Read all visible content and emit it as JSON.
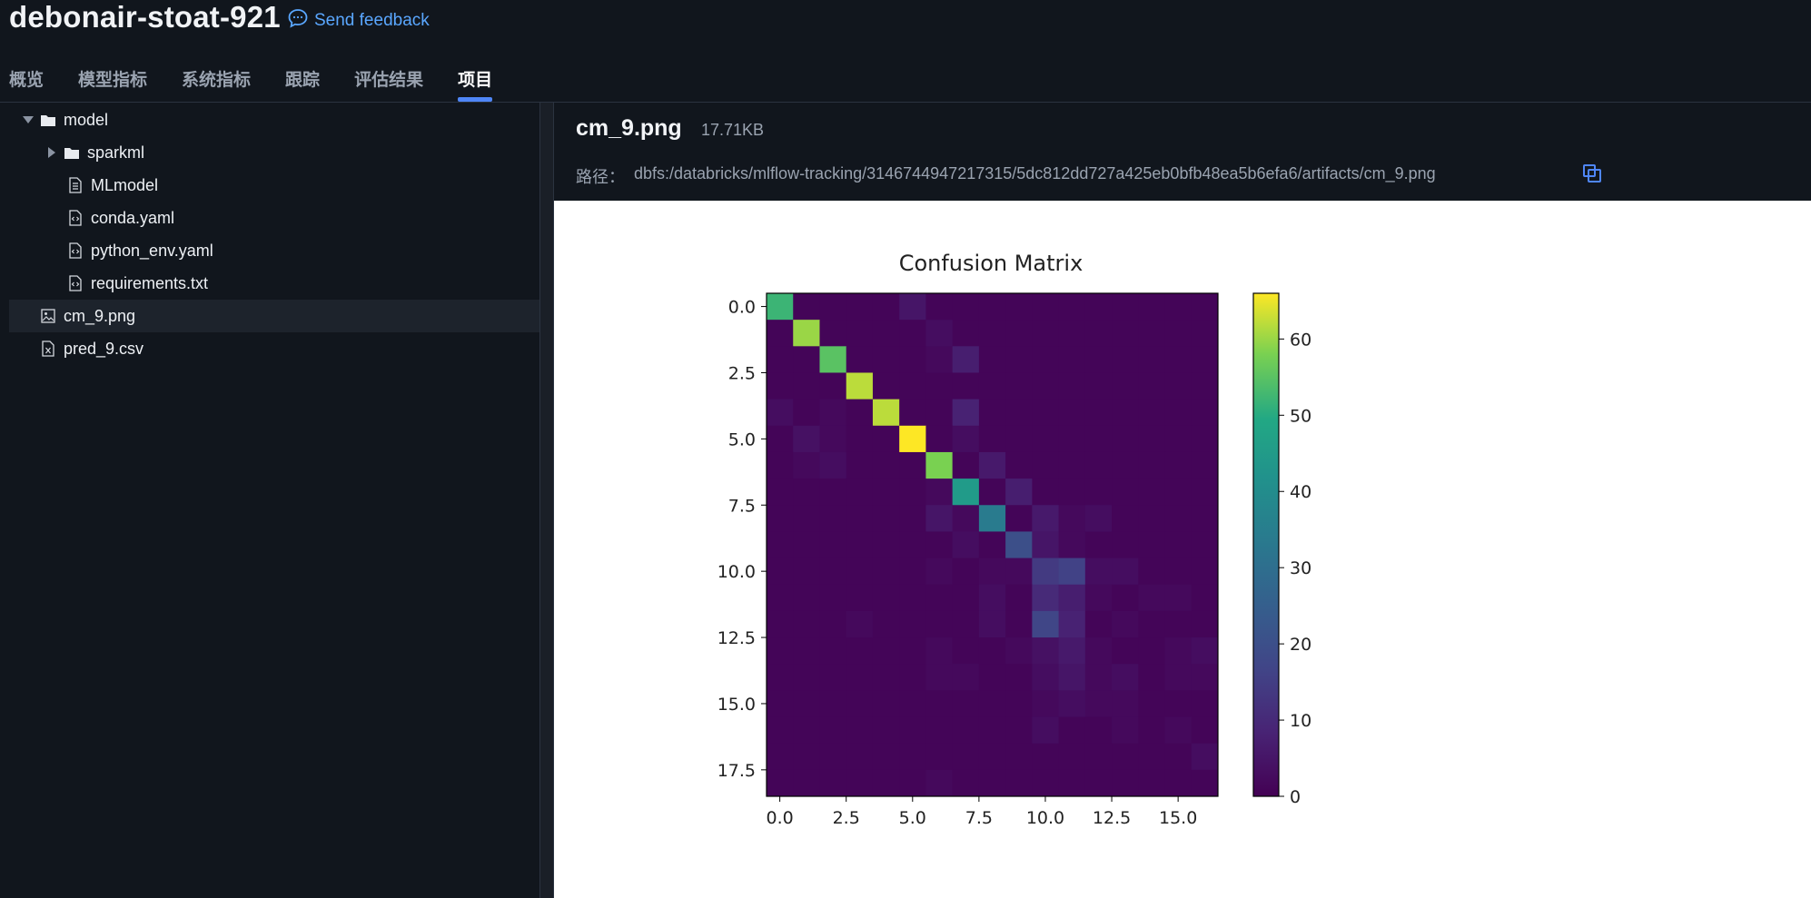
{
  "header": {
    "title": "debonair-stoat-921",
    "feedback_label": "Send feedback"
  },
  "tabs": [
    {
      "label": "概览",
      "active": false
    },
    {
      "label": "模型指标",
      "active": false
    },
    {
      "label": "系统指标",
      "active": false
    },
    {
      "label": "跟踪",
      "active": false
    },
    {
      "label": "评估结果",
      "active": false
    },
    {
      "label": "项目",
      "active": true
    }
  ],
  "tree": {
    "model": "model",
    "sparkml": "sparkml",
    "mlmodel": "MLmodel",
    "conda": "conda.yaml",
    "python_env": "python_env.yaml",
    "requirements": "requirements.txt",
    "cm": "cm_9.png",
    "pred": "pred_9.csv"
  },
  "file": {
    "name": "cm_9.png",
    "size": "17.71KB",
    "path_label": "路径：",
    "path": "dbfs:/databricks/mlflow-tracking/3146744947217315/5dc812dd727a425eb0bfb48ea5b6efa6/artifacts/cm_9.png"
  },
  "colors": {
    "accent": "#4f86f7",
    "link": "#5aa7ff",
    "background": "#11161d"
  },
  "chart_data": {
    "type": "heatmap",
    "title": "Confusion Matrix",
    "colormap": "viridis",
    "rows": 19,
    "cols": 17,
    "vmin": 0,
    "vmax": 66,
    "xticks": [
      "0.0",
      "2.5",
      "5.0",
      "7.5",
      "10.0",
      "12.5",
      "15.0"
    ],
    "yticks": [
      "0.0",
      "2.5",
      "5.0",
      "7.5",
      "10.0",
      "12.5",
      "15.0",
      "17.5"
    ],
    "colorbar_ticks": [
      "0",
      "10",
      "20",
      "30",
      "40",
      "50",
      "60"
    ],
    "matrix": [
      [
        52,
        1,
        1,
        1,
        1,
        5,
        1,
        1,
        1,
        1,
        1,
        1,
        1,
        1,
        1,
        1,
        1
      ],
      [
        1,
        60,
        1,
        1,
        1,
        1,
        3,
        1,
        1,
        1,
        1,
        1,
        1,
        1,
        1,
        1,
        1
      ],
      [
        1,
        1,
        55,
        1,
        1,
        1,
        2,
        7,
        1,
        1,
        1,
        1,
        1,
        1,
        1,
        1,
        1
      ],
      [
        1,
        1,
        1,
        62,
        1,
        1,
        1,
        1,
        1,
        1,
        1,
        1,
        1,
        1,
        1,
        1,
        1
      ],
      [
        3,
        1,
        2,
        1,
        62,
        1,
        1,
        8,
        1,
        1,
        1,
        1,
        1,
        1,
        1,
        1,
        1
      ],
      [
        1,
        4,
        2,
        1,
        1,
        66,
        1,
        3,
        1,
        1,
        1,
        1,
        1,
        1,
        1,
        1,
        1
      ],
      [
        1,
        2,
        3,
        1,
        1,
        1,
        58,
        1,
        6,
        1,
        1,
        1,
        1,
        1,
        1,
        1,
        1
      ],
      [
        1,
        1,
        1,
        1,
        1,
        1,
        2,
        45,
        1,
        7,
        1,
        1,
        1,
        1,
        1,
        1,
        1
      ],
      [
        1,
        1,
        1,
        1,
        1,
        1,
        5,
        2,
        34,
        1,
        6,
        2,
        3,
        1,
        1,
        1,
        1
      ],
      [
        1,
        1,
        1,
        1,
        1,
        1,
        1,
        3,
        1,
        20,
        5,
        2,
        1,
        1,
        1,
        1,
        1
      ],
      [
        1,
        1,
        1,
        1,
        1,
        1,
        2,
        1,
        2,
        2,
        14,
        16,
        3,
        3,
        1,
        1,
        1
      ],
      [
        1,
        1,
        1,
        1,
        1,
        1,
        1,
        1,
        3,
        1,
        10,
        7,
        2,
        1,
        2,
        2,
        1
      ],
      [
        1,
        1,
        1,
        2,
        1,
        1,
        1,
        1,
        3,
        1,
        17,
        8,
        1,
        2,
        1,
        1,
        1
      ],
      [
        1,
        1,
        1,
        1,
        1,
        1,
        2,
        1,
        1,
        2,
        4,
        6,
        2,
        1,
        1,
        2,
        3
      ],
      [
        1,
        1,
        1,
        1,
        1,
        1,
        2,
        2,
        1,
        1,
        3,
        5,
        2,
        3,
        1,
        2,
        2
      ],
      [
        1,
        1,
        1,
        1,
        1,
        1,
        1,
        1,
        1,
        1,
        2,
        3,
        2,
        2,
        1,
        1,
        1
      ],
      [
        1,
        1,
        1,
        1,
        1,
        1,
        1,
        1,
        1,
        1,
        3,
        1,
        1,
        2,
        1,
        2,
        1
      ],
      [
        1,
        1,
        1,
        1,
        1,
        1,
        1,
        1,
        1,
        1,
        1,
        1,
        1,
        1,
        1,
        1,
        3
      ],
      [
        1,
        1,
        1,
        1,
        1,
        1,
        2,
        1,
        1,
        1,
        1,
        1,
        1,
        1,
        1,
        1,
        1
      ]
    ]
  }
}
